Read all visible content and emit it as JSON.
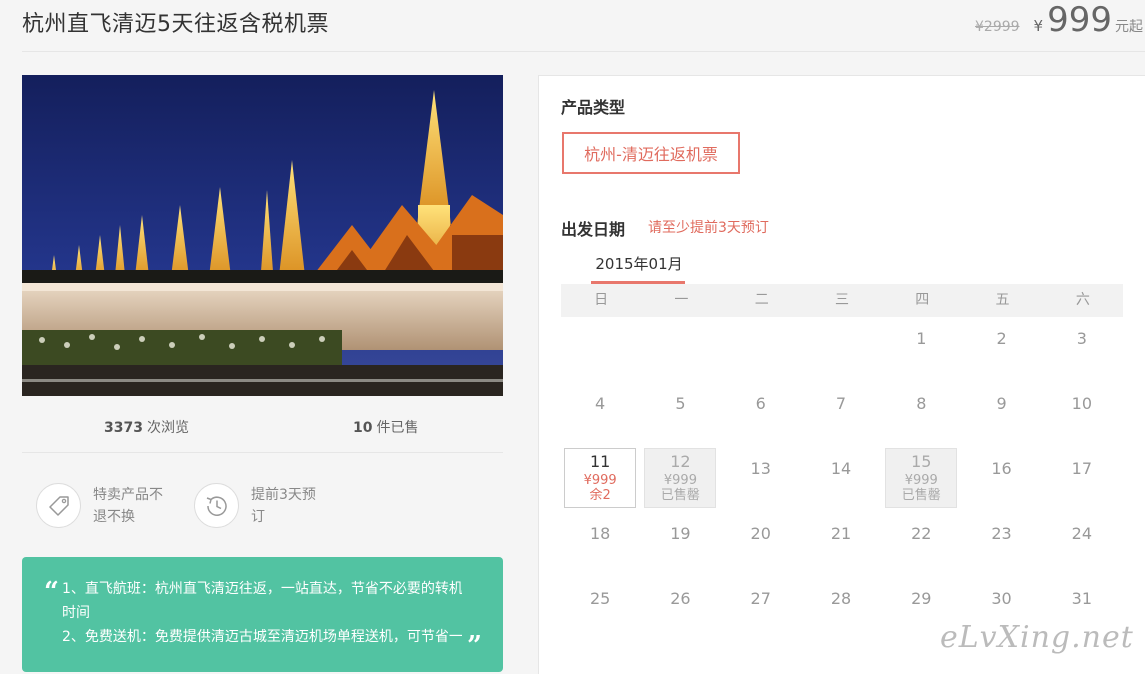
{
  "header": {
    "title": "杭州直飞清迈5天往返含税机票",
    "old_price": "¥2999",
    "currency": "¥",
    "price": "999",
    "price_unit": "元起"
  },
  "stats": {
    "views_count": "3373",
    "views_label": "次浏览",
    "sold_count": "10",
    "sold_label": "件已售"
  },
  "features": [
    {
      "icon": "tag-icon",
      "text": "特卖产品不退不换"
    },
    {
      "icon": "clock-icon",
      "text": "提前3天预订"
    }
  ],
  "highlights": {
    "line1": "1、直飞航班：杭州直飞清迈往返，一站直达，节省不必要的转机",
    "line1_cont": "时间",
    "line2": "2、免费送机：免费提供清迈古城至清迈机场单程送机，可节省一"
  },
  "product_type": {
    "label": "产品类型",
    "option": "杭州-清迈往返机票"
  },
  "departure": {
    "label": "出发日期",
    "hint": "请至少提前3天预订",
    "month": "2015年01月",
    "weekdays": [
      "日",
      "一",
      "二",
      "三",
      "四",
      "五",
      "六"
    ],
    "days": [
      {
        "day": "1",
        "col": 4,
        "row": 0
      },
      {
        "day": "2",
        "col": 5,
        "row": 0
      },
      {
        "day": "3",
        "col": 6,
        "row": 0
      },
      {
        "day": "4",
        "col": 0,
        "row": 1
      },
      {
        "day": "5",
        "col": 1,
        "row": 1
      },
      {
        "day": "6",
        "col": 2,
        "row": 1
      },
      {
        "day": "7",
        "col": 3,
        "row": 1
      },
      {
        "day": "8",
        "col": 4,
        "row": 1
      },
      {
        "day": "9",
        "col": 5,
        "row": 1
      },
      {
        "day": "10",
        "col": 6,
        "row": 1
      },
      {
        "day": "11",
        "col": 0,
        "row": 2,
        "status": "available",
        "price": "¥999",
        "stock": "余2"
      },
      {
        "day": "12",
        "col": 1,
        "row": 2,
        "status": "soldout",
        "price": "¥999",
        "stock": "已售罄"
      },
      {
        "day": "13",
        "col": 2,
        "row": 2
      },
      {
        "day": "14",
        "col": 3,
        "row": 2
      },
      {
        "day": "15",
        "col": 4,
        "row": 2,
        "status": "soldout",
        "price": "¥999",
        "stock": "已售罄"
      },
      {
        "day": "16",
        "col": 5,
        "row": 2
      },
      {
        "day": "17",
        "col": 6,
        "row": 2
      },
      {
        "day": "18",
        "col": 0,
        "row": 3
      },
      {
        "day": "19",
        "col": 1,
        "row": 3
      },
      {
        "day": "20",
        "col": 2,
        "row": 3
      },
      {
        "day": "21",
        "col": 3,
        "row": 3
      },
      {
        "day": "22",
        "col": 4,
        "row": 3
      },
      {
        "day": "23",
        "col": 5,
        "row": 3
      },
      {
        "day": "24",
        "col": 6,
        "row": 3
      },
      {
        "day": "25",
        "col": 0,
        "row": 4
      },
      {
        "day": "26",
        "col": 1,
        "row": 4
      },
      {
        "day": "27",
        "col": 2,
        "row": 4
      },
      {
        "day": "28",
        "col": 3,
        "row": 4
      },
      {
        "day": "29",
        "col": 4,
        "row": 4
      },
      {
        "day": "30",
        "col": 5,
        "row": 4
      },
      {
        "day": "31",
        "col": 6,
        "row": 4
      }
    ]
  },
  "watermark": "eLvXing.net",
  "colors": {
    "accent": "#e06b5e",
    "highlight_bg": "#52c3a2"
  }
}
